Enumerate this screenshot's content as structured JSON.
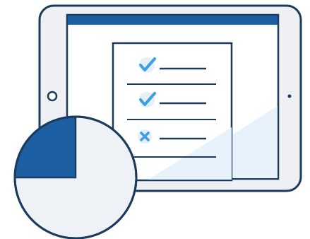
{
  "illustration": {
    "device": "tablet",
    "checklist": {
      "items": [
        {
          "mark": "check",
          "icon": "check-icon"
        },
        {
          "mark": "check",
          "icon": "check-icon"
        },
        {
          "mark": "cross",
          "icon": "cross-icon"
        }
      ]
    },
    "pie_progress_fraction": 0.25
  },
  "colors": {
    "outline": "#1b3a5c",
    "accent_dark": "#1d5fa3",
    "accent_light": "#3aa0e4",
    "device_body": "#eef0f4",
    "screen": "#ffffff",
    "paper": "#ffffff",
    "pie_background": "#eef2f7"
  }
}
